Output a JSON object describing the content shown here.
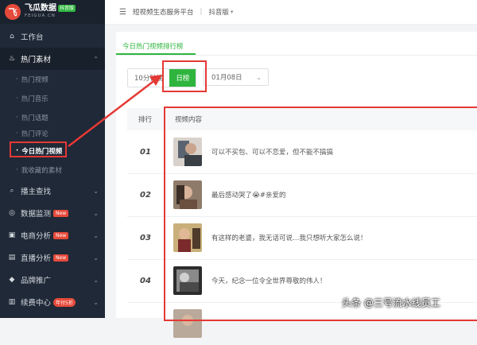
{
  "logo": {
    "mark": "飞",
    "name": "飞瓜数据",
    "badge": "抖音版",
    "domain": "FEIGUA.CN"
  },
  "topbar": {
    "title": "短视频生态服务平台",
    "platform": "抖音版"
  },
  "sidebar": {
    "workbench": "工作台",
    "hot_materials": "热门素材",
    "sub_items": [
      "热门视频",
      "热门音乐",
      "热门话题",
      "热门评论",
      "今日热门视频",
      "我收藏的素材"
    ],
    "sections": [
      {
        "label": "播主查找"
      },
      {
        "label": "数据监测",
        "badge": "New"
      },
      {
        "label": "电商分析",
        "badge": "New"
      },
      {
        "label": "直播分析",
        "badge": "New"
      },
      {
        "label": "品牌推广"
      },
      {
        "label": "续费中心",
        "badge": "年付5折"
      }
    ]
  },
  "content": {
    "tab": "今日热门视频排行榜",
    "toggle": {
      "left": "10分钟榜",
      "right": "日榜"
    },
    "date": "01月08日",
    "table": {
      "headers": [
        "排行",
        "视频内容"
      ],
      "rows": [
        {
          "rank": "01",
          "text": "可以不买包、可以不恋爱，但不能不搞搞"
        },
        {
          "rank": "02",
          "text": "最后感动哭了😭#亲爱的"
        },
        {
          "rank": "03",
          "text": "有这样的老婆，我无话可说…我只想听大家怎么说！"
        },
        {
          "rank": "04",
          "text": "今天，纪念一位令全世界尊敬的伟人！"
        }
      ]
    }
  },
  "watermark": "头条 @三号流水线员工",
  "colors": {
    "sidebar": "#1f2937",
    "accent": "#2fb53e",
    "highlight": "#e53935",
    "brand": "#e64a3b"
  }
}
